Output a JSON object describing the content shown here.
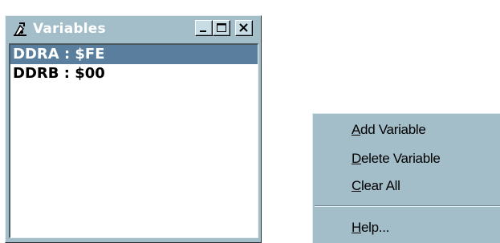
{
  "window": {
    "title": "Variables",
    "icon": "variables-tool-icon",
    "title_bar_color": "#5a7f9e",
    "controls": [
      "minimize-icon",
      "maximize-icon",
      "close-icon"
    ]
  },
  "variables": {
    "items": [
      {
        "text": "DDRA : $FE",
        "selected": true
      },
      {
        "text": "DDRB : $00",
        "selected": false
      }
    ]
  },
  "context_menu": {
    "items": [
      {
        "accel": "A",
        "rest": "dd Variable"
      },
      {
        "accel": "D",
        "rest": "elete Variable"
      },
      {
        "accel": "C",
        "rest": "lear All"
      },
      {
        "accel": "H",
        "rest": "elp..."
      }
    ]
  },
  "colors": {
    "window_face": "#a3bdc9",
    "selection": "#5a7f9e",
    "list_background": "#ffffff"
  }
}
